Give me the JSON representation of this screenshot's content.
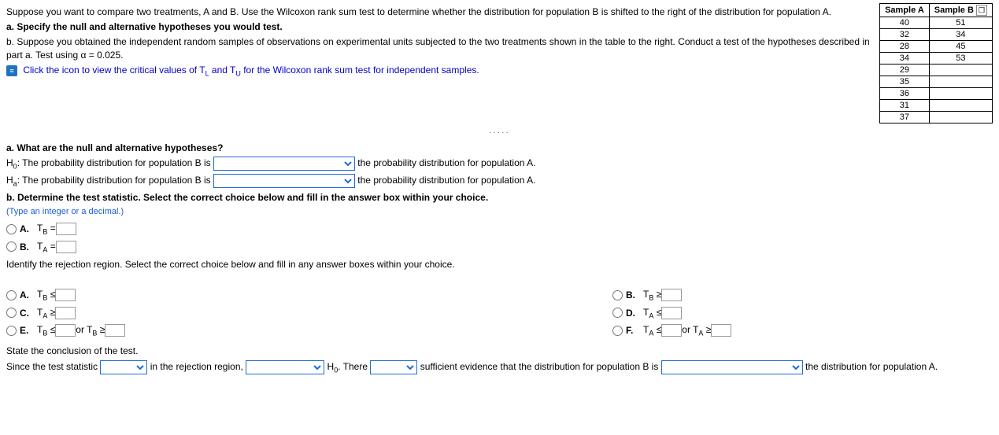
{
  "intro": {
    "p1": "Suppose you want to compare two treatments, A and B. Use the Wilcoxon rank sum test to determine whether the distribution for population B is shifted to the right of the distribution for population A.",
    "a_line": "a. Specify the null and alternative hypotheses you would test.",
    "b_line": "b. Suppose you obtained the independent random samples of observations on experimental units subjected to the two treatments shown in the table to the right. Conduct a test of the hypotheses described in part a. Test using α = 0.025.",
    "link_text": "Click the icon to view the critical values of T",
    "link_mid": " and T",
    "link_end": " for the Wilcoxon rank sum test for independent samples."
  },
  "table": {
    "hA": "Sample A",
    "hB": "Sample B",
    "a": [
      "40",
      "32",
      "28",
      "34",
      "29",
      "35",
      "36",
      "31",
      "37"
    ],
    "b": [
      "51",
      "34",
      "45",
      "53",
      "",
      "",
      "",
      "",
      ""
    ]
  },
  "dots": "·····",
  "qa": {
    "heading": "a. What are the null and alternative hypotheses?",
    "h0_pre": "H",
    "h0_text": ": The probability distribution for population B is",
    "h0_post": "the probability distribution for population A.",
    "ha_text": ": The probability distribution for population B is",
    "ha_post": "the probability distribution for population A."
  },
  "qb": {
    "heading": "b. Determine the test statistic. Select the correct choice below and fill in the answer box within your choice.",
    "hint": "(Type an integer or a decimal.)",
    "optA": "A.",
    "tb": "T",
    "tb_sub": "B",
    "eq": " = ",
    "optB": "B.",
    "ta": "T",
    "ta_sub": "A"
  },
  "rej": {
    "heading": "Identify the rejection region. Select the correct choice below and fill in any answer boxes within your choice.",
    "A": "A.",
    "B": "B.",
    "C": "C.",
    "D": "D.",
    "E": "E.",
    "F": "F.",
    "le": " ≤ ",
    "ge": " ≥ ",
    "or": " or T"
  },
  "concl": {
    "heading": "State the conclusion of the test.",
    "p1": "Since the test statistic",
    "p2": "in the rejection region,",
    "p3": "H",
    "p3b": ". There",
    "p4": "sufficient evidence that the distribution for population B is",
    "p5": "the distribution for population A."
  }
}
